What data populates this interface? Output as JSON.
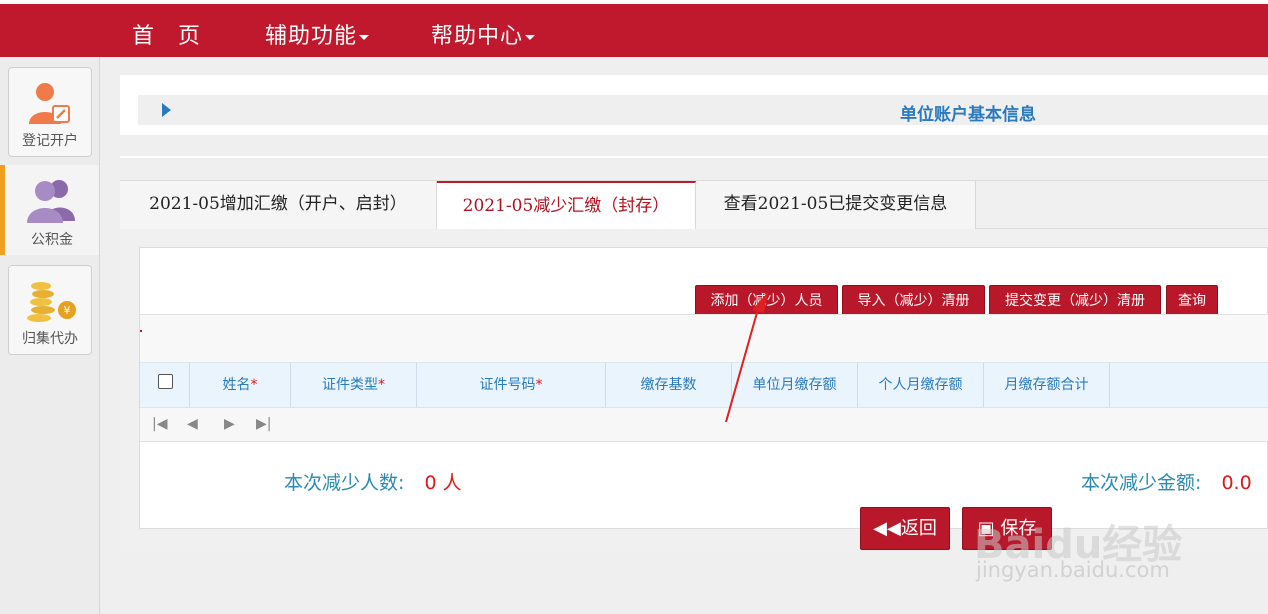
{
  "nav": {
    "home": "首　页",
    "assist": "辅助功能",
    "help": "帮助中心"
  },
  "sidebar": {
    "items": [
      {
        "label": "登记开户",
        "icon": "person-edit-icon"
      },
      {
        "label": "公积金",
        "icon": "people-icon"
      },
      {
        "label": "归集代办",
        "icon": "coins-icon"
      }
    ]
  },
  "panel": {
    "title": "单位账户基本信息"
  },
  "tabs": [
    {
      "label": "2021-05增加汇缴（开户、启封）"
    },
    {
      "label": "2021-05减少汇缴（封存）"
    },
    {
      "label": "查看2021-05已提交变更信息"
    }
  ],
  "toolbar": {
    "add": "添加（减少）人员",
    "import": "导入（减少）清册",
    "submit": "提交变更（减少）清册",
    "query": "查询"
  },
  "grid": {
    "columns": [
      {
        "label": "姓名",
        "required": "*"
      },
      {
        "label": "证件类型",
        "required": "*"
      },
      {
        "label": "证件号码",
        "required": "*"
      },
      {
        "label": "缴存基数",
        "required": ""
      },
      {
        "label": "单位月缴存额",
        "required": ""
      },
      {
        "label": "个人月缴存额",
        "required": ""
      },
      {
        "label": "月缴存额合计",
        "required": ""
      }
    ]
  },
  "summary": {
    "count_label": "本次减少人数:",
    "count_value": "0 人",
    "amount_label": "本次减少金额:",
    "amount_value": "0.0"
  },
  "footer": {
    "back": "返回",
    "save": "保存"
  },
  "watermark": {
    "text": "Baidu经验",
    "url": "jingyan.baidu.com"
  },
  "colors": {
    "brand": "#c0182c",
    "accent_blue": "#2a7ac0",
    "sidebar_active": "#f0a020"
  }
}
